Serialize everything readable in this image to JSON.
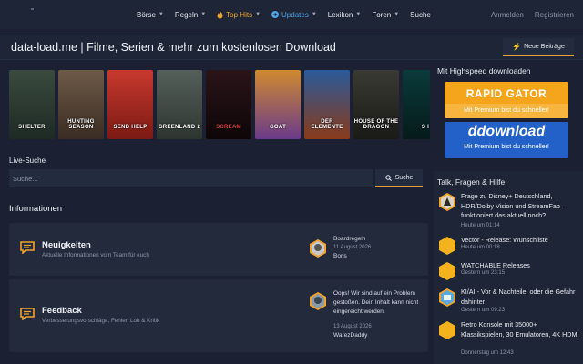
{
  "nav": {
    "items": [
      {
        "label": "Börse",
        "caret": true
      },
      {
        "label": "Regeln",
        "caret": true
      },
      {
        "label": "Top Hits",
        "caret": true,
        "icon": "flame-icon"
      },
      {
        "label": "Updates",
        "caret": true,
        "icon": "arrow-right-circle-icon"
      },
      {
        "label": "Lexikon",
        "caret": true
      },
      {
        "label": "Foren",
        "caret": true
      },
      {
        "label": "Suche",
        "caret": false
      }
    ],
    "login": "Anmelden",
    "register": "Registrieren"
  },
  "header": {
    "title": "data-load.me | Filme, Serien & mehr zum kostenlosen Download",
    "new_posts_label": "Neue Beiträge"
  },
  "carousel": {
    "posters": [
      {
        "text": "SHELTER",
        "color_top": "#3a4a3e",
        "color_bottom": "#1e2a24"
      },
      {
        "text": "HUNTING SEASON",
        "color_top": "#6e5a48",
        "color_bottom": "#3a2c22"
      },
      {
        "text": "SEND HELP",
        "color_top": "#c8392e",
        "color_bottom": "#7a1a14"
      },
      {
        "text": "GREENLAND 2",
        "color_top": "#55605a",
        "color_bottom": "#2e3530"
      },
      {
        "text": "SCREAM",
        "color_top": "#2a1418",
        "color_bottom": "#0e0608"
      },
      {
        "text": "GOAT",
        "color_top": "#d08a30",
        "color_bottom": "#6a3a8a"
      },
      {
        "text": "DER ELEMENTE",
        "color_top": "#2a5a9a",
        "color_bottom": "#8a3a1a"
      },
      {
        "text": "HOUSE OF THE DRAGON",
        "color_top": "#3a3a34",
        "color_bottom": "#1a1a16"
      },
      {
        "text": "S I",
        "color_top": "#0a3a3a",
        "color_bottom": "#061a1a"
      }
    ]
  },
  "sidebar": {
    "downloads_heading": "Mit Highspeed downloaden",
    "ads": [
      {
        "title": "RAPID GATOR",
        "subtitle": "Mit Premium bist du schneller!",
        "color": "#f4a51c"
      },
      {
        "title": "ddownload",
        "subtitle": "Mit Premium bist du schneller!",
        "color": "#2361c9"
      }
    ],
    "talk": {
      "heading": "Talk, Fragen & Hilfe",
      "items": [
        {
          "title": "Frage zu Disney+ Deutschland, HDR/Dolby Vision und StreamFab – funktioniert das aktuell noch?",
          "time": "Heute um 01:14",
          "avatar": "character-avatar"
        },
        {
          "title": "Vector - Release: Wunschliste",
          "time": "Heute um 00:18",
          "avatar": "hexagon-avatar"
        },
        {
          "title": "WATCHABLE Releases",
          "time": "Gestern um 23:15",
          "avatar": "hexagon-avatar"
        },
        {
          "title": "KI/AI - Vor & Nachteile, oder die Gefahr dahinter",
          "time": "Gestern um 09:23",
          "avatar": "robot-avatar"
        },
        {
          "title": "Retro Konsole mit 35000+ Klassikspielen, 30 Emulatoren, 4K HDMI",
          "time": "Donnerstag um 12:43",
          "avatar": "hexagon-avatar"
        }
      ]
    }
  },
  "search": {
    "label": "Live-Suche",
    "placeholder": "Suche...",
    "button_label": "Suche"
  },
  "info": {
    "heading": "Informationen",
    "boards": [
      {
        "title": "Neuigkeiten",
        "description": "Aktuelle Informationen vom Team für euch",
        "last_post": {
          "title": "Boardregeln",
          "date": "11 August 2026",
          "user": "Boris"
        }
      },
      {
        "title": "Feedback",
        "description": "Verbesserungsvorschläge, Fehler, Lob & Kritik",
        "last_post": {
          "title": "Oops! Wir sind auf ein Problem gestoßen. Dein Inhalt kann nicht eingereicht werden.",
          "date": "13 August 2026",
          "user": "WarezDaddy"
        }
      }
    ]
  },
  "colors": {
    "accent": "#f0a32c",
    "background": "#1b2132",
    "panel": "#222a3c",
    "updates_blue": "#4da3e6"
  }
}
